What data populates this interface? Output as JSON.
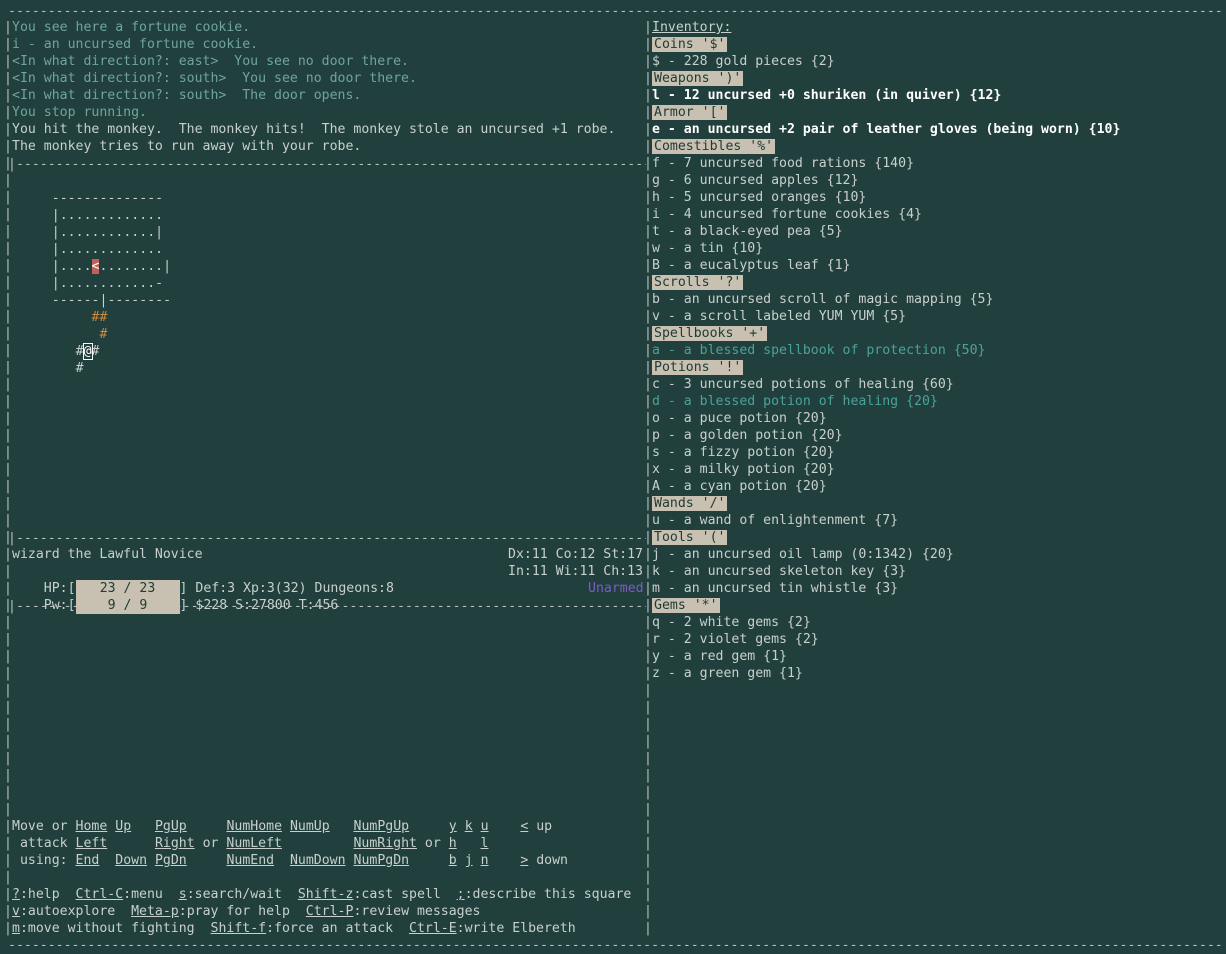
{
  "messages": [
    "You see here a fortune cookie.",
    "i - an uncursed fortune cookie.",
    "<In what direction?: east>  You see no door there.",
    "<In what direction?: south>  You see no door there.",
    "<In what direction?: south>  The door opens.",
    "You stop running.",
    "You hit the monkey.  The monkey hits!  The monkey stole an uncursed +1 robe.",
    "The monkey tries to run away with your robe."
  ],
  "status": {
    "name": "wizard the Lawful Novice",
    "hp_label": "HP:[",
    "hp": "23 / 23",
    "hp_fill": 1.0,
    "def_line": "] Def:3 Xp:3(32) Dungeons:8",
    "pw_label": "Pw:[",
    "pw": "9 / 9",
    "pw_fill": 1.0,
    "money_line": "] $228 S:27800 T:456",
    "stats1": "Dx:11 Co:12 St:17",
    "stats2": "In:11 Wi:11 Ch:13",
    "weapon": "Unarmed"
  },
  "inventory": {
    "title": "Inventory:",
    "sections": [
      {
        "header": "Coins '$'",
        "items": [
          {
            "text": "$ - 228 gold pieces {2}",
            "style": ""
          }
        ]
      },
      {
        "header": "Weapons ')'",
        "items": [
          {
            "text": "l - 12 uncursed +0 shuriken (in quiver) {12}",
            "style": "bold"
          }
        ]
      },
      {
        "header": "Armor '['",
        "items": [
          {
            "text": "e - an uncursed +2 pair of leather gloves (being worn) {10}",
            "style": "bold"
          }
        ]
      },
      {
        "header": "Comestibles '%'",
        "items": [
          {
            "text": "f - 7 uncursed food rations {140}",
            "style": ""
          },
          {
            "text": "g - 6 uncursed apples {12}",
            "style": ""
          },
          {
            "text": "h - 5 uncursed oranges {10}",
            "style": ""
          },
          {
            "text": "i - 4 uncursed fortune cookies {4}",
            "style": ""
          },
          {
            "text": "t - a black-eyed pea {5}",
            "style": ""
          },
          {
            "text": "w - a tin {10}",
            "style": ""
          },
          {
            "text": "B - a eucalyptus leaf {1}",
            "style": ""
          }
        ]
      },
      {
        "header": "Scrolls '?'",
        "items": [
          {
            "text": "b - an uncursed scroll of magic mapping {5}",
            "style": ""
          },
          {
            "text": "v - a scroll labeled YUM YUM {5}",
            "style": ""
          }
        ]
      },
      {
        "header": "Spellbooks '+'",
        "items": [
          {
            "text": "a - a blessed spellbook of protection {50}",
            "style": "teal"
          }
        ]
      },
      {
        "header": "Potions '!'",
        "items": [
          {
            "text": "c - 3 uncursed potions of healing {60}",
            "style": ""
          },
          {
            "text": "d - a blessed potion of healing {20}",
            "style": "teal"
          },
          {
            "text": "o - a puce potion {20}",
            "style": ""
          },
          {
            "text": "p - a golden potion {20}",
            "style": ""
          },
          {
            "text": "s - a fizzy potion {20}",
            "style": ""
          },
          {
            "text": "x - a milky potion {20}",
            "style": ""
          },
          {
            "text": "A - a cyan potion {20}",
            "style": ""
          }
        ]
      },
      {
        "header": "Wands '/'",
        "items": [
          {
            "text": "u - a wand of enlightenment {7}",
            "style": ""
          }
        ]
      },
      {
        "header": "Tools '('",
        "items": [
          {
            "text": "j - an uncursed oil lamp (0:1342) {20}",
            "style": ""
          },
          {
            "text": "k - an uncursed skeleton key {3}",
            "style": ""
          },
          {
            "text": "m - an uncursed tin whistle {3}",
            "style": ""
          }
        ]
      },
      {
        "header": "Gems '*'",
        "items": [
          {
            "text": "q - 2 white gems {2}",
            "style": ""
          },
          {
            "text": "r - 2 violet gems {2}",
            "style": ""
          },
          {
            "text": "y - a red gem {1}",
            "style": ""
          },
          {
            "text": "z - a green gem {1}",
            "style": ""
          }
        ]
      }
    ]
  },
  "help": {
    "move1": {
      "p": "Move or ",
      "a": "Home",
      "b": "Up",
      "c": "PgUp",
      "d": "NumHome",
      "e": "NumUp",
      "f": "NumPgUp",
      "g": "y",
      "h": "k",
      "i": "u",
      "j": "<",
      "k": " up"
    },
    "move2": {
      "p": " attack ",
      "a": "Left",
      "c": "Right",
      "or1": " or ",
      "d": "NumLeft",
      "f": "NumRight",
      "or2": " or ",
      "g": "h",
      "i": "l"
    },
    "move3": {
      "p": " using: ",
      "a": "End",
      "b": "Down",
      "c": "PgDn",
      "d": "NumEnd",
      "e": "NumDown",
      "f": "NumPgDn",
      "g": "b",
      "h": "j",
      "i": "n",
      "j": ">",
      "k": " down"
    },
    "cmd1": [
      {
        "k": "?",
        "t": ":help  "
      },
      {
        "k": "Ctrl-C",
        "t": ":menu  "
      },
      {
        "k": "s",
        "t": ":search/wait  "
      },
      {
        "k": "Shift-z",
        "t": ":cast spell  "
      },
      {
        "k": ";",
        "t": ":describe this square"
      }
    ],
    "cmd2": [
      {
        "k": "v",
        "t": ":autoexplore  "
      },
      {
        "k": "Meta-p",
        "t": ":pray for help  "
      },
      {
        "k": "Ctrl-P",
        "t": ":review messages"
      }
    ],
    "cmd3": [
      {
        "k": "m",
        "t": ":move without fighting  "
      },
      {
        "k": "Shift-f",
        "t": ":force an attack  "
      },
      {
        "k": "Ctrl-E",
        "t": ":write Elbereth"
      }
    ]
  },
  "map": {
    "rows": [
      "     --------------",
      "     |.............",
      "     |............|",
      "     |.............",
      "     |....<........|",
      "     |............-",
      "     ------|--------",
      "          ##",
      "           #",
      "        #@#",
      "        #"
    ]
  },
  "colors": {
    "background": "#213f3c",
    "header_bg": "#c8c0b0",
    "teal": "#4aa39a",
    "upstair_bg": "#c0605a",
    "corridor": "#d08a3a",
    "unarmed": "#7a5cc8"
  }
}
